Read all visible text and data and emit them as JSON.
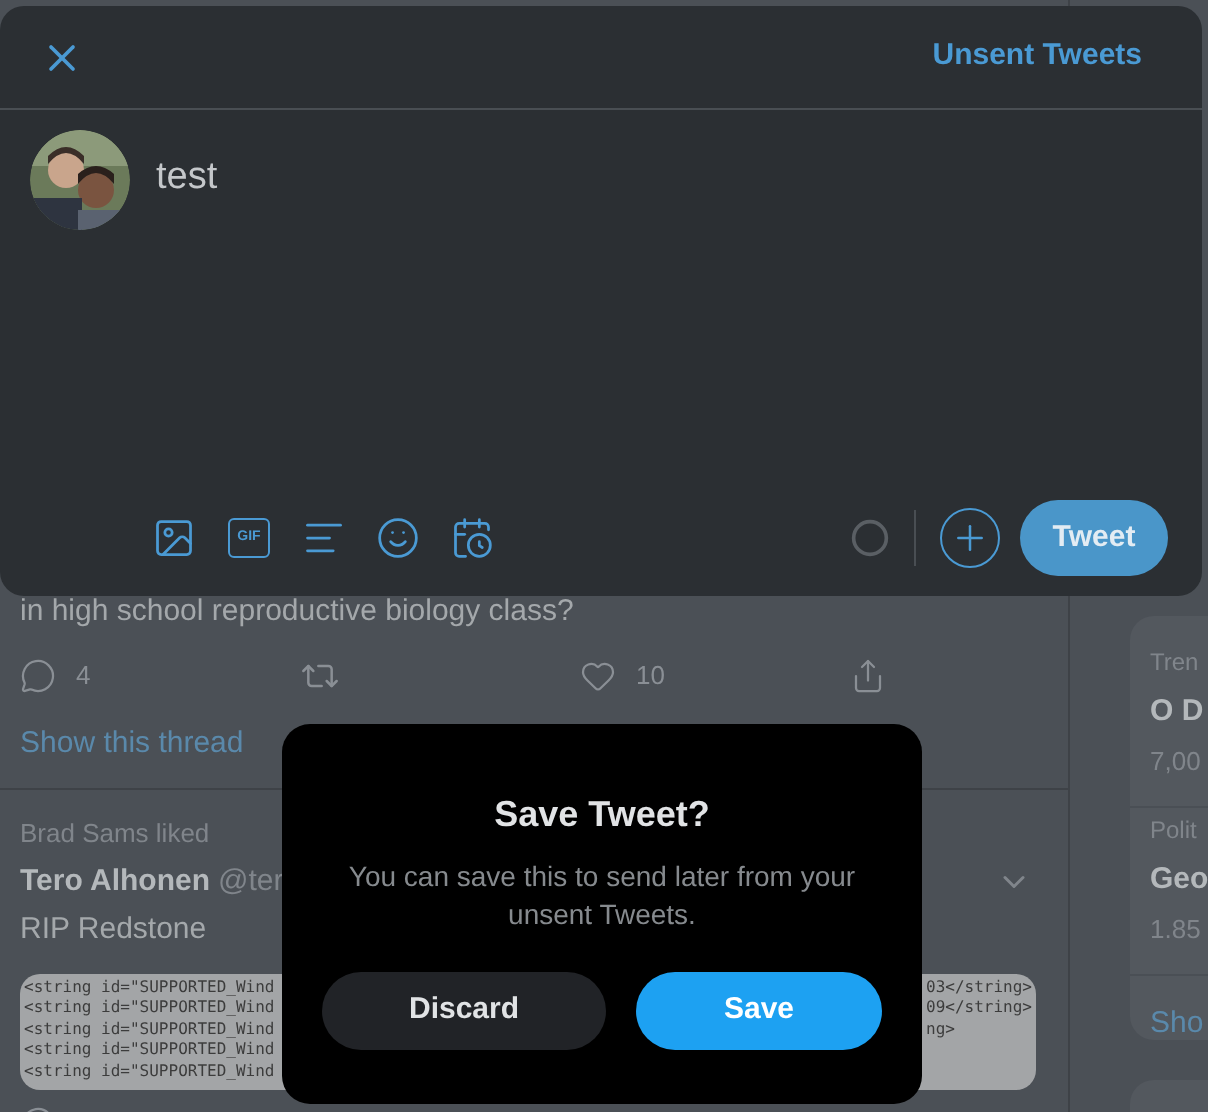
{
  "compose": {
    "drafts_link": "Unsent Tweets",
    "text": "test",
    "gif_label": "GIF",
    "tweet_button": "Tweet"
  },
  "feed": [
    {
      "kind": "tail",
      "text": "in high school reproductive biology class?",
      "replies": "4",
      "likes": "10",
      "thread_link": "Show this thread"
    },
    {
      "kind": "tweet",
      "context": "Brad Sams liked",
      "name": "Tero Alhonen",
      "handle": "@ter",
      "text": "RIP Redstone",
      "code_left": [
        "<string id=\"SUPPORTED_Wind",
        "<string id=\"SUPPORTED_Wind",
        "<string id=\"SUPPORTED_Wind",
        "<string id=\"SUPPORTED_Wind",
        "<string id=\"SUPPORTED_Wind"
      ],
      "code_right": [
        "03</string>",
        "09</string>",
        "ng>"
      ]
    }
  ],
  "sidebar": {
    "sections": [
      {
        "label": "Tren",
        "title": "O D",
        "count": "7,00"
      },
      {
        "label": "Polit",
        "title": "Geo",
        "count": "1.85"
      }
    ],
    "more_link": "Sho"
  },
  "dialog": {
    "title": "Save Tweet?",
    "body": "You can save this to send later from your unsent Tweets.",
    "buttons": [
      {
        "label": "Discard",
        "kind": "secondary"
      },
      {
        "label": "Save",
        "kind": "primary"
      }
    ]
  }
}
